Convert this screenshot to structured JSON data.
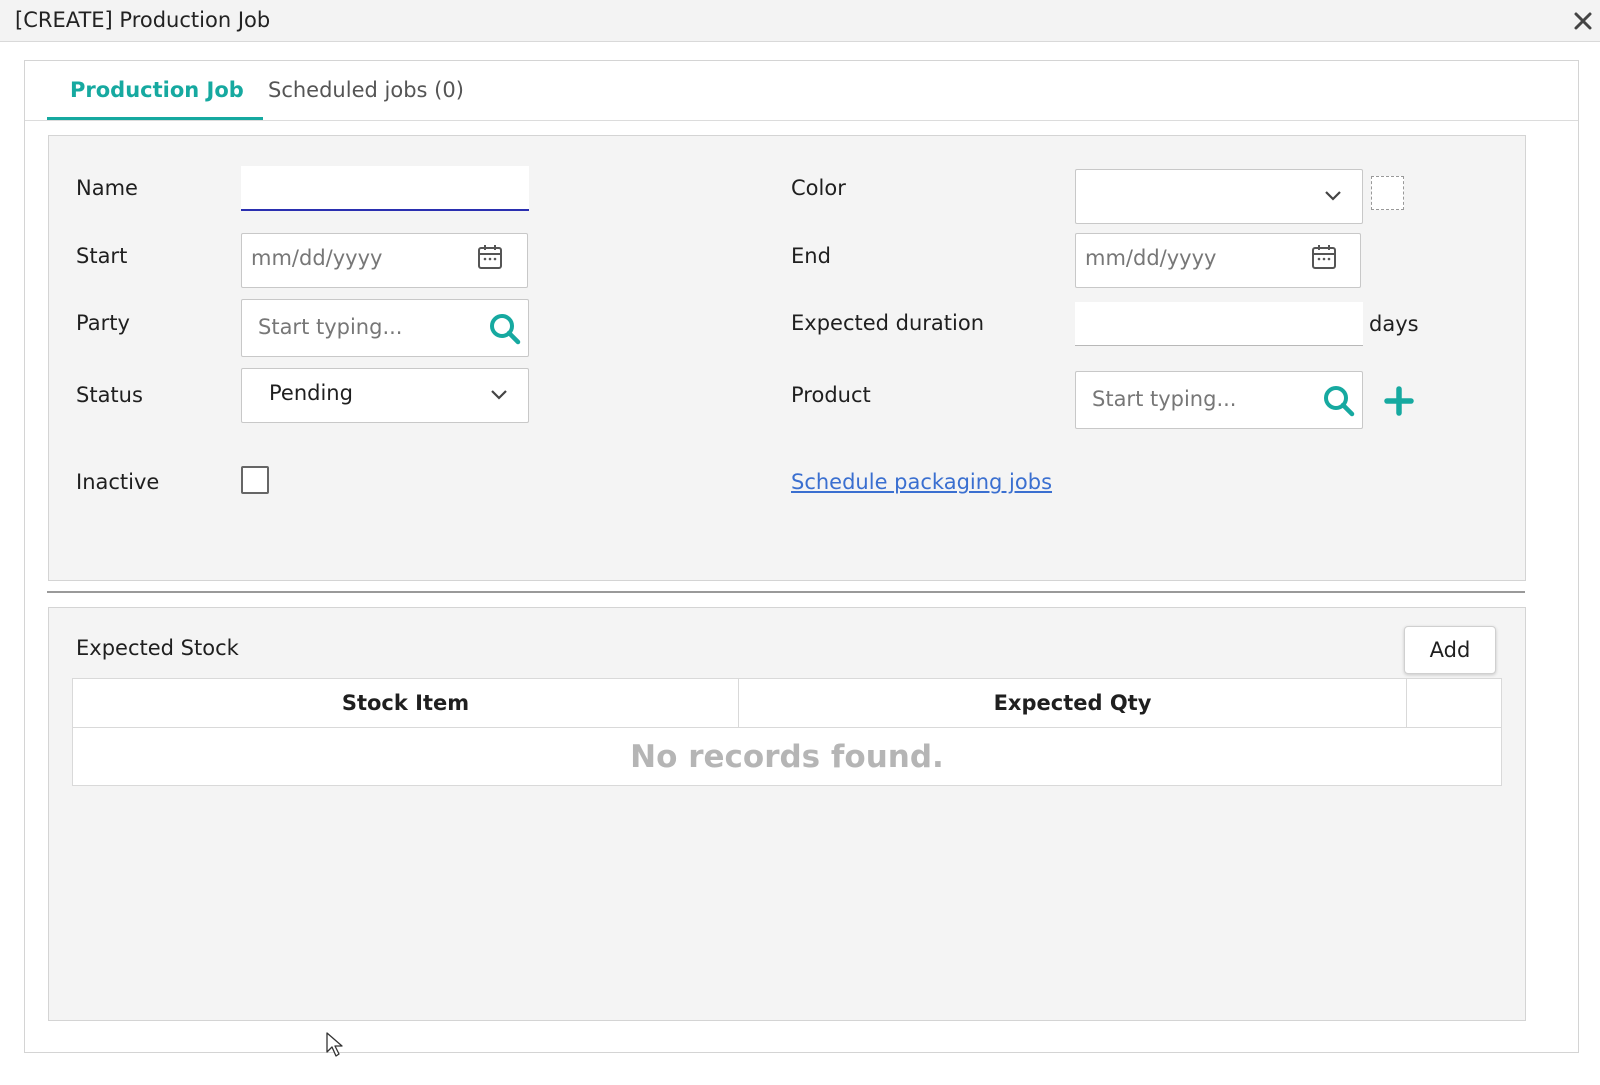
{
  "window": {
    "title": "[CREATE] Production Job"
  },
  "tabs": [
    {
      "label": "Production Job",
      "active": true
    },
    {
      "label": "Scheduled jobs (0)",
      "active": false
    }
  ],
  "form": {
    "name": {
      "label": "Name",
      "value": ""
    },
    "start": {
      "label": "Start",
      "placeholder": "mm/dd/yyyy"
    },
    "party": {
      "label": "Party",
      "placeholder": "Start typing..."
    },
    "status": {
      "label": "Status",
      "value": "Pending"
    },
    "inactive": {
      "label": "Inactive",
      "checked": false
    },
    "color": {
      "label": "Color",
      "value": ""
    },
    "end": {
      "label": "End",
      "placeholder": "mm/dd/yyyy"
    },
    "expected_duration": {
      "label": "Expected duration",
      "value": "",
      "unit": "days"
    },
    "product": {
      "label": "Product",
      "placeholder": "Start typing..."
    },
    "schedule_link": "Schedule packaging jobs"
  },
  "stock": {
    "title": "Expected Stock",
    "add_label": "Add",
    "columns": [
      "Stock Item",
      "Expected Qty",
      ""
    ],
    "empty_message": "No records found."
  },
  "colors": {
    "accent": "#16a9a0",
    "link": "#3a6fd0",
    "focus": "#2a2fb0"
  }
}
